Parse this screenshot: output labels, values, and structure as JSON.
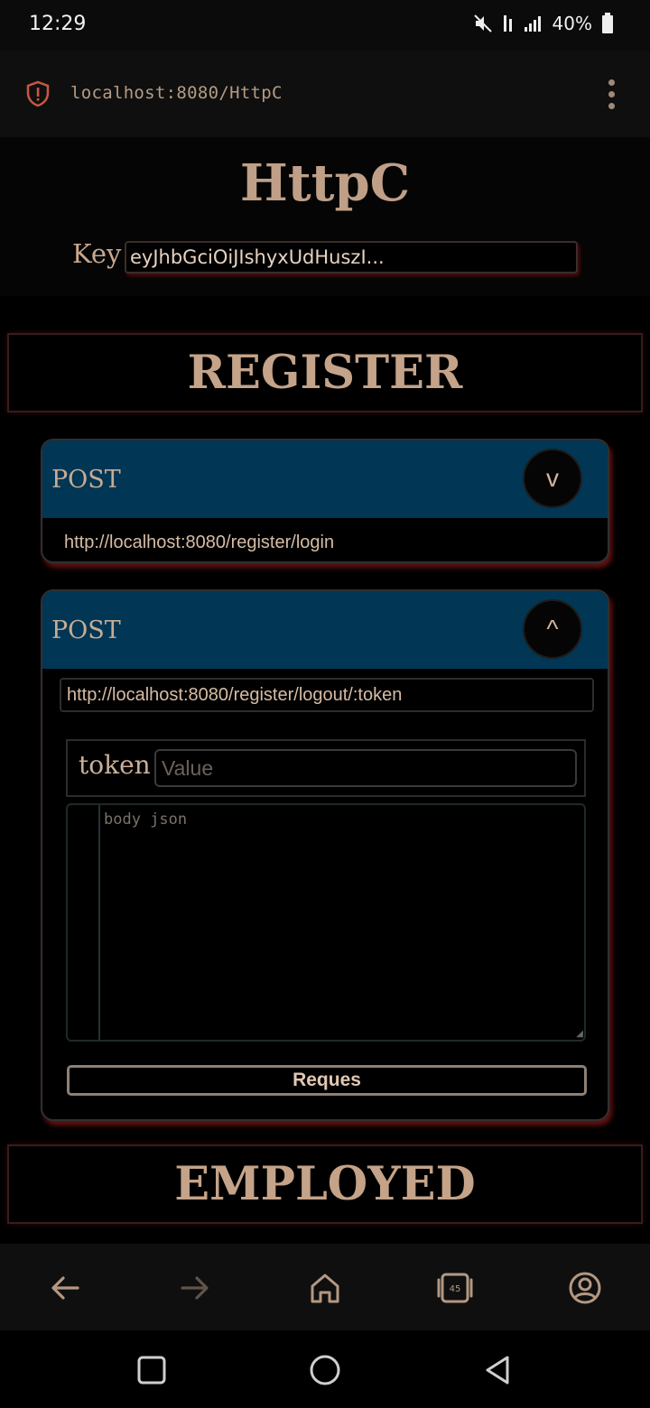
{
  "status_bar": {
    "time": "12:29",
    "battery": "40%"
  },
  "browser": {
    "url": "localhost:8080/HttpC",
    "tabs_count": "45"
  },
  "app": {
    "title": "HttpC",
    "key_label": "Key",
    "key_value": "eyJhbGciOiJIshyxUdHuszI..."
  },
  "sections": [
    {
      "title": "REGISTER"
    },
    {
      "title": "EMPLOYED"
    }
  ],
  "endpoints": [
    {
      "method": "POST",
      "url": "http://localhost:8080/register/login",
      "expanded": false,
      "toggle": "v"
    },
    {
      "method": "POST",
      "url": "http://localhost:8080/register/logout/:token",
      "expanded": true,
      "toggle": "^",
      "param_name": "token",
      "param_placeholder": "Value",
      "body_placeholder": "body json",
      "request_label": "Reques"
    }
  ],
  "colors": {
    "accent": "#bf9f87",
    "card_header": "#013655",
    "background": "#000000"
  }
}
